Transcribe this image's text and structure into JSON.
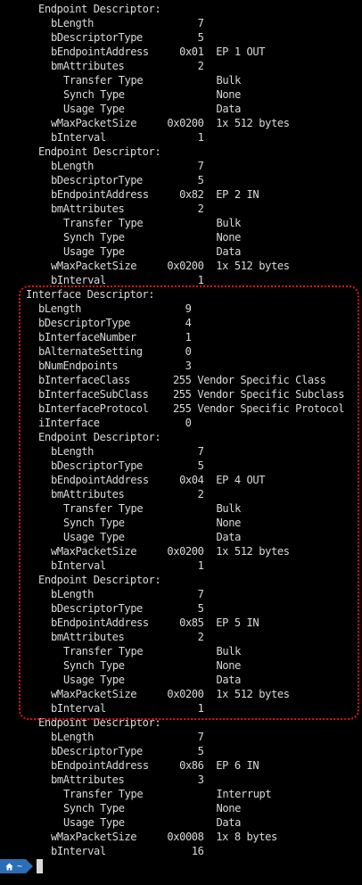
{
  "terminal": {
    "lines": [
      {
        "t": "Endpoint Descriptor:",
        "i": 3
      },
      {
        "t": "bLength                 7",
        "i": 4
      },
      {
        "t": "bDescriptorType         5",
        "i": 4
      },
      {
        "t": "bEndpointAddress     0x01  EP 1 OUT",
        "i": 4
      },
      {
        "t": "bmAttributes            2",
        "i": 4
      },
      {
        "t": "Transfer Type            Bulk",
        "i": 5
      },
      {
        "t": "Synch Type               None",
        "i": 5
      },
      {
        "t": "Usage Type               Data",
        "i": 5
      },
      {
        "t": "wMaxPacketSize     0x0200  1x 512 bytes",
        "i": 4
      },
      {
        "t": "bInterval               1",
        "i": 4
      },
      {
        "t": "Endpoint Descriptor:",
        "i": 3
      },
      {
        "t": "bLength                 7",
        "i": 4
      },
      {
        "t": "bDescriptorType         5",
        "i": 4
      },
      {
        "t": "bEndpointAddress     0x82  EP 2 IN",
        "i": 4
      },
      {
        "t": "bmAttributes            2",
        "i": 4
      },
      {
        "t": "Transfer Type            Bulk",
        "i": 5
      },
      {
        "t": "Synch Type               None",
        "i": 5
      },
      {
        "t": "Usage Type               Data",
        "i": 5
      },
      {
        "t": "wMaxPacketSize     0x0200  1x 512 bytes",
        "i": 4
      },
      {
        "t": "bInterval               1",
        "i": 4
      },
      {
        "t": "Interface Descriptor:",
        "i": 2
      },
      {
        "t": "bLength                 9",
        "i": 3
      },
      {
        "t": "bDescriptorType         4",
        "i": 3
      },
      {
        "t": "bInterfaceNumber        1",
        "i": 3
      },
      {
        "t": "bAlternateSetting       0",
        "i": 3
      },
      {
        "t": "bNumEndpoints           3",
        "i": 3
      },
      {
        "t": "bInterfaceClass       255 Vendor Specific Class",
        "i": 3
      },
      {
        "t": "bInterfaceSubClass    255 Vendor Specific Subclass",
        "i": 3
      },
      {
        "t": "bInterfaceProtocol    255 Vendor Specific Protocol",
        "i": 3
      },
      {
        "t": "iInterface              0",
        "i": 3
      },
      {
        "t": "Endpoint Descriptor:",
        "i": 3
      },
      {
        "t": "bLength                 7",
        "i": 4
      },
      {
        "t": "bDescriptorType         5",
        "i": 4
      },
      {
        "t": "bEndpointAddress     0x04  EP 4 OUT",
        "i": 4
      },
      {
        "t": "bmAttributes            2",
        "i": 4
      },
      {
        "t": "Transfer Type            Bulk",
        "i": 5
      },
      {
        "t": "Synch Type               None",
        "i": 5
      },
      {
        "t": "Usage Type               Data",
        "i": 5
      },
      {
        "t": "wMaxPacketSize     0x0200  1x 512 bytes",
        "i": 4
      },
      {
        "t": "bInterval               1",
        "i": 4
      },
      {
        "t": "Endpoint Descriptor:",
        "i": 3
      },
      {
        "t": "bLength                 7",
        "i": 4
      },
      {
        "t": "bDescriptorType         5",
        "i": 4
      },
      {
        "t": "bEndpointAddress     0x85  EP 5 IN",
        "i": 4
      },
      {
        "t": "bmAttributes            2",
        "i": 4
      },
      {
        "t": "Transfer Type            Bulk",
        "i": 5
      },
      {
        "t": "Synch Type               None",
        "i": 5
      },
      {
        "t": "Usage Type               Data",
        "i": 5
      },
      {
        "t": "wMaxPacketSize     0x0200  1x 512 bytes",
        "i": 4
      },
      {
        "t": "bInterval               1",
        "i": 4
      },
      {
        "t": "Endpoint Descriptor:",
        "i": 3
      },
      {
        "t": "bLength                 7",
        "i": 4
      },
      {
        "t": "bDescriptorType         5",
        "i": 4
      },
      {
        "t": "bEndpointAddress     0x86  EP 6 IN",
        "i": 4
      },
      {
        "t": "bmAttributes            3",
        "i": 4
      },
      {
        "t": "Transfer Type            Interrupt",
        "i": 5
      },
      {
        "t": "Synch Type               None",
        "i": 5
      },
      {
        "t": "Usage Type               Data",
        "i": 5
      },
      {
        "t": "wMaxPacketSize     0x0008  1x 8 bytes",
        "i": 4
      },
      {
        "t": "bInterval              16",
        "i": 4
      }
    ]
  },
  "prompt": {
    "home_icon": "home-icon",
    "path": "~"
  },
  "colors": {
    "highlight": "#e3141b",
    "prompt_bg": "#2a6fb5",
    "text": "#d9d9d9"
  }
}
